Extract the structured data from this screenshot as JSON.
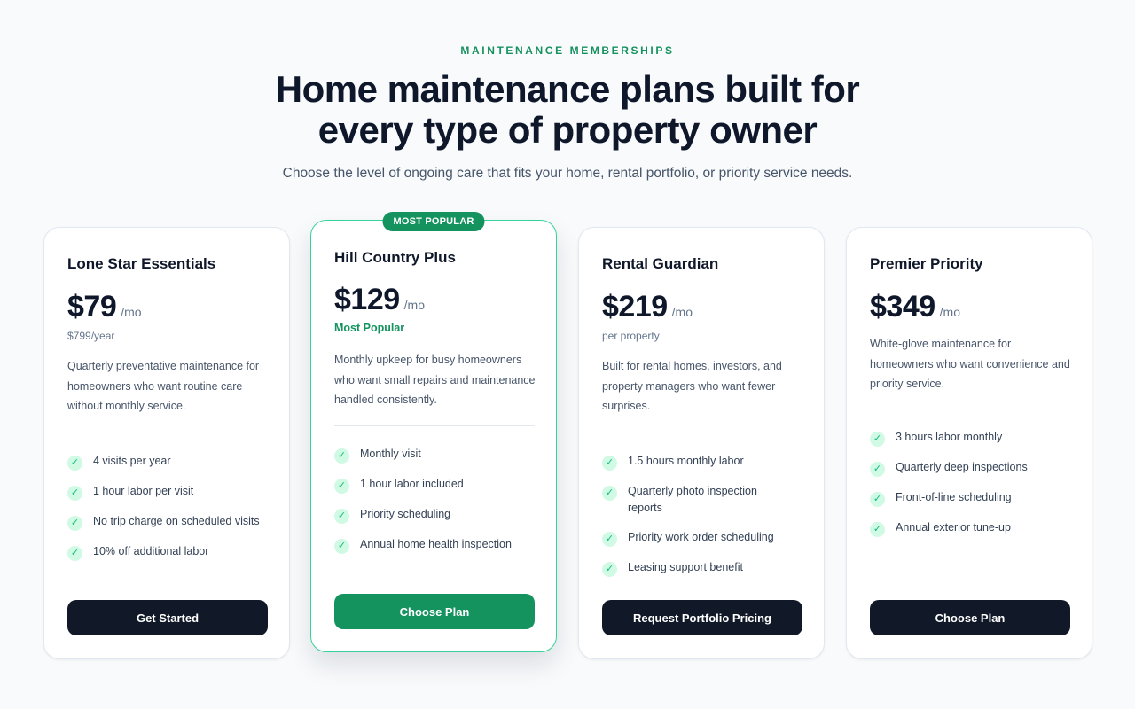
{
  "header": {
    "eyebrow": "MAINTENANCE MEMBERSHIPS",
    "title_line1": "Home maintenance plans built for",
    "title_line2": "every type of property owner",
    "subtitle": "Choose the level of ongoing care that fits your home, rental portfolio, or priority service needs."
  },
  "plans": [
    {
      "name": "Lone Star Essentials",
      "price": "$79",
      "period": "/mo",
      "note": "$799/year",
      "description": "Quarterly preventative maintenance for homeowners who want routine care without monthly service.",
      "features": [
        "4 visits per year",
        "1 hour labor per visit",
        "No trip charge on scheduled visits",
        "10% off additional labor"
      ],
      "cta": "Get Started"
    },
    {
      "badge": "MOST POPULAR",
      "name": "Hill Country Plus",
      "price": "$129",
      "period": "/mo",
      "note": "Most Popular",
      "description": "Monthly upkeep for busy homeowners who want small repairs and maintenance handled consistently.",
      "features": [
        "Monthly visit",
        "1 hour labor included",
        "Priority scheduling",
        "Annual home health inspection"
      ],
      "cta": "Choose Plan"
    },
    {
      "name": "Rental Guardian",
      "price": "$219",
      "period": "/mo",
      "note": "per property",
      "description": "Built for rental homes, investors, and property managers who want fewer surprises.",
      "features": [
        "1.5 hours monthly labor",
        "Quarterly photo inspection reports",
        "Priority work order scheduling",
        "Leasing support benefit"
      ],
      "cta": "Request Portfolio Pricing"
    },
    {
      "name": "Premier Priority",
      "price": "$349",
      "period": "/mo",
      "description": "White-glove maintenance for homeowners who want convenience and priority service.",
      "features": [
        "3 hours labor monthly",
        "Quarterly deep inspections",
        "Front-of-line scheduling",
        "Annual exterior tune-up"
      ],
      "cta": "Choose Plan"
    }
  ],
  "icons": {
    "feature_check": "check-icon"
  },
  "colors": {
    "accent": "#14935f",
    "dark_button": "#111827",
    "check_bg": "#d1fae5"
  }
}
